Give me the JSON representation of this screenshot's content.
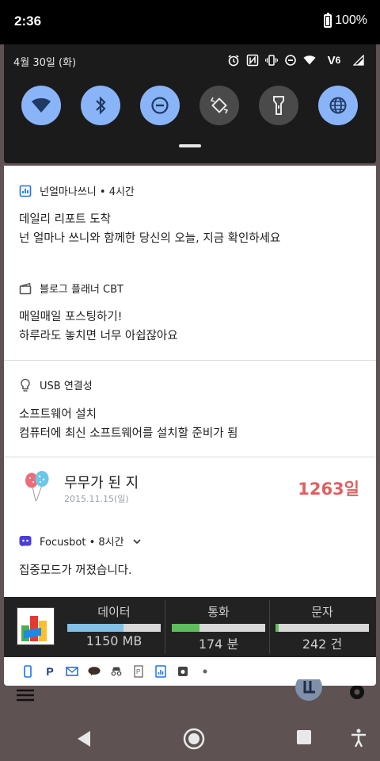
{
  "status_bar": {
    "time": "2:36",
    "battery": "100%"
  },
  "quick_settings": {
    "date": "4월 30일 (화)",
    "status_icons": [
      "alarm-icon",
      "nfc-icon",
      "vibrate-icon",
      "dnd-icon",
      "wifi-icon",
      "volte-icon",
      "signal-icon"
    ],
    "tiles": [
      {
        "name": "wifi-tile",
        "icon": "wifi-icon",
        "state": "on"
      },
      {
        "name": "bluetooth-tile",
        "icon": "bluetooth-icon",
        "state": "on"
      },
      {
        "name": "dnd-tile",
        "icon": "dnd-icon",
        "state": "on"
      },
      {
        "name": "autorotate-tile",
        "icon": "rotate-icon",
        "state": "off"
      },
      {
        "name": "flashlight-tile",
        "icon": "flashlight-icon",
        "state": "off"
      },
      {
        "name": "globe-tile",
        "icon": "globe-icon",
        "state": "on"
      }
    ],
    "accent_color": "#8ab4f8"
  },
  "notifications": [
    {
      "app": "넌얼마나쓰니",
      "time": "4시간",
      "title": "데일리 리포트 도착",
      "body": "넌 얼마나 쓰니와 함께한 당신의 오늘, 지금 확인하세요"
    },
    {
      "app": "블로그 플래너 CBT",
      "title": "매일매일 포스팅하기!",
      "body": "하루라도 놓치면 너무 아쉽잖아요"
    },
    {
      "app": "USB 연결성",
      "title": "소프트웨어 설치",
      "body": "컴퓨터에 최신 소프트웨어를 설치할 준비가 됨"
    },
    {
      "title": "무무가 된 지",
      "date": "2015.11.15(일)",
      "count": "1263일"
    },
    {
      "app": "Focusbot",
      "time": "8시간",
      "body": "집중모드가 꺼졌습니다."
    }
  ],
  "usage_widget": {
    "columns": [
      {
        "label": "데이터",
        "value": "1150 MB",
        "fill": 0.6,
        "color": "#82c0e6"
      },
      {
        "label": "통화",
        "value": "174 분",
        "fill": 0.3,
        "color": "#5cbf5c"
      },
      {
        "label": "문자",
        "value": "242 건",
        "fill": 0.03,
        "color": "#5cbf5c"
      }
    ]
  },
  "bottom_strip_icons": [
    "phone-icon",
    "paypal-icon",
    "mail-icon",
    "talk-icon",
    "incognito-icon",
    "parking-icon",
    "report-icon",
    "photo-icon",
    "dot-icon"
  ],
  "nav": [
    "back-icon",
    "home-icon",
    "recents-icon",
    "accessibility-icon"
  ]
}
